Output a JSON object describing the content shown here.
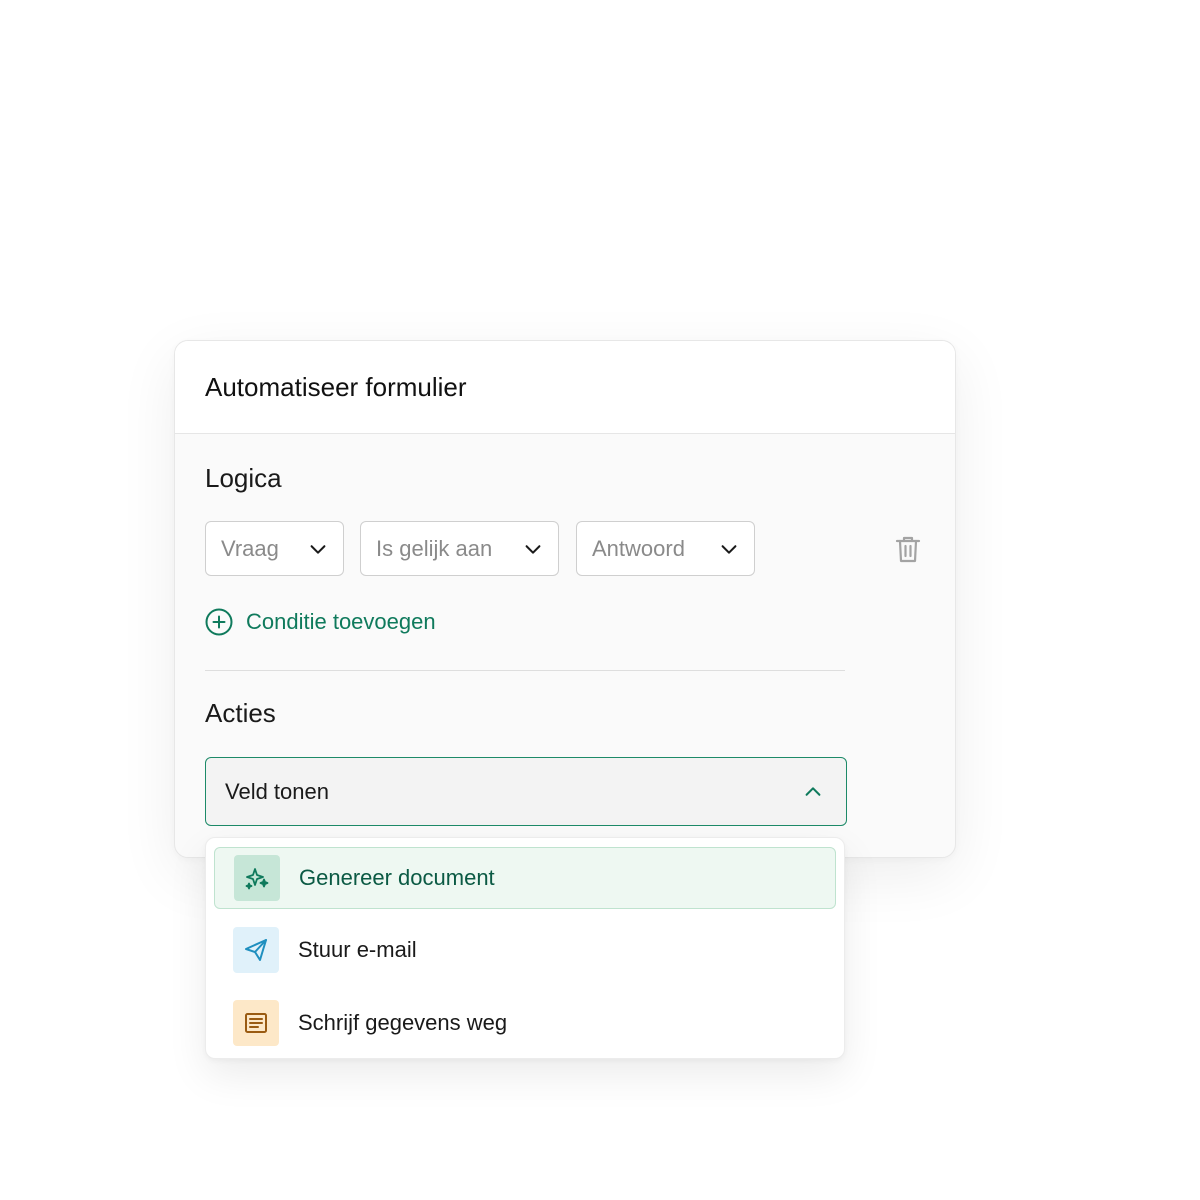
{
  "card": {
    "title": "Automatiseer formulier"
  },
  "logic": {
    "title": "Logica",
    "selects": [
      {
        "placeholder": "Vraag",
        "icon": "chevron-down-icon"
      },
      {
        "placeholder": "Is gelijk aan",
        "icon": "chevron-down-icon"
      },
      {
        "placeholder": "Antwoord",
        "icon": "chevron-down-icon"
      }
    ],
    "delete_icon": "trash-icon",
    "add_condition": {
      "label": "Conditie toevoegen",
      "icon": "plus-circle-icon"
    }
  },
  "actions": {
    "title": "Acties",
    "select": {
      "value": "Veld tonen",
      "icon": "chevron-up-icon",
      "state": "open"
    },
    "options": [
      {
        "label": "Genereer document",
        "icon": "sparkles-icon",
        "highlighted": true
      },
      {
        "label": "Stuur e-mail",
        "icon": "send-icon",
        "highlighted": false
      },
      {
        "label": "Schrijf gegevens weg",
        "icon": "document-lines-icon",
        "highlighted": false
      }
    ]
  },
  "colors": {
    "accent": "#0f7a5c",
    "accent_border": "#1d8a68",
    "highlight_bg": "#eef8f2",
    "sparkle_bg": "#c6e6d7",
    "send_bg": "#e0f1fa",
    "send_icon": "#1f8fbf",
    "doc_bg": "#fde8c8",
    "doc_icon": "#9a5b12"
  }
}
